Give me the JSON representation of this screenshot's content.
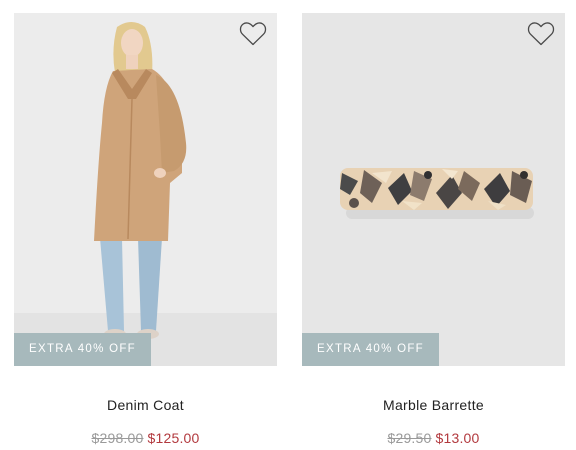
{
  "products": [
    {
      "name": "Denim Coat",
      "badge": "EXTRA 40% OFF",
      "original_price": "$298.00",
      "sale_price": "$125.00",
      "wishlist_icon": "heart-outline-icon"
    },
    {
      "name": "Marble Barrette",
      "badge": "EXTRA 40% OFF",
      "original_price": "$29.50",
      "sale_price": "$13.00",
      "wishlist_icon": "heart-outline-icon"
    }
  ],
  "colors": {
    "badge_bg": "#a7b9bc",
    "sale_price": "#b2393e",
    "original_price": "#9a9a9a"
  }
}
